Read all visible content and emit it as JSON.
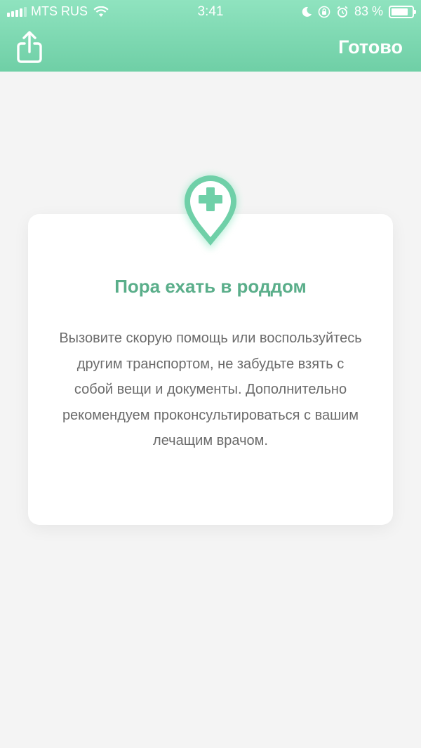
{
  "status_bar": {
    "carrier": "MTS RUS",
    "time": "3:41",
    "battery_percent": "83 %",
    "battery_level": 0.83,
    "icons": [
      "signal-icon",
      "wifi-icon",
      "moon-icon",
      "orientation-lock-icon",
      "alarm-icon",
      "battery-icon"
    ]
  },
  "nav": {
    "share_icon": "share-icon",
    "done_label": "Готово"
  },
  "card": {
    "icon": "hospital-pin-icon",
    "title": "Пора ехать в роддом",
    "text": "Вызовите скорую помощь или воспользуйтесь другим транспортом, не забудьте взять с собой вещи и документы. Дополнительно рекомендуем проконсультироваться с вашим лечащим врачом."
  },
  "colors": {
    "header_top": "#8fe3bf",
    "header_bottom": "#6fcfa6",
    "accent": "#6fd0a8",
    "title": "#5aae8a",
    "background": "#f4f4f4"
  }
}
